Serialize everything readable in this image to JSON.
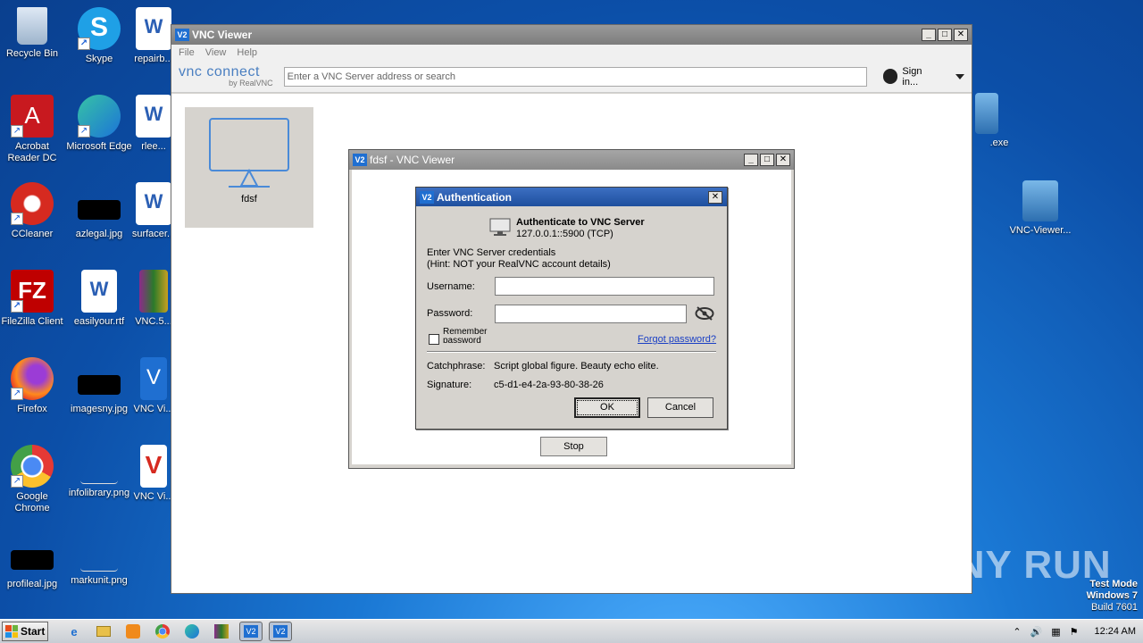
{
  "desktop": {
    "icons": [
      {
        "label": "Recycle Bin"
      },
      {
        "label": "Skype"
      },
      {
        "label": "repairb..."
      },
      {
        "label": "Acrobat Reader DC"
      },
      {
        "label": "Microsoft Edge"
      },
      {
        "label": "rlee..."
      },
      {
        "label": "CCleaner"
      },
      {
        "label": "azlegal.jpg"
      },
      {
        "label": "surfacer..."
      },
      {
        "label": "FileZilla Client"
      },
      {
        "label": "easilyour.rtf"
      },
      {
        "label": "VNC.5..."
      },
      {
        "label": "Firefox"
      },
      {
        "label": "imagesny.jpg"
      },
      {
        "label": "VNC Vi..."
      },
      {
        "label": "Google Chrome"
      },
      {
        "label": "infolibrary.png"
      },
      {
        "label": "VNC Vi..."
      },
      {
        "label": "profileal.jpg"
      },
      {
        "label": "markunit.png"
      },
      {
        "label": ".exe"
      },
      {
        "label": "VNC-Viewer..."
      }
    ]
  },
  "main_window": {
    "title": "VNC Viewer",
    "menu": [
      "File",
      "View",
      "Help"
    ],
    "brand_top": "vnc connect",
    "brand_bottom": "by RealVNC",
    "search_placeholder": "Enter a VNC Server address or search",
    "signin": "Sign in...",
    "tile_label": "fdsf"
  },
  "session_window": {
    "title": "fdsf - VNC Viewer",
    "stop_label": "Stop"
  },
  "auth_dialog": {
    "title": "Authentication",
    "heading": "Authenticate to VNC Server",
    "server": "127.0.0.1::5900 (TCP)",
    "prompt_line1": "Enter VNC Server credentials",
    "prompt_line2": "(Hint: NOT your RealVNC account details)",
    "username_label": "Username:",
    "username_value": "",
    "password_label": "Password:",
    "password_value": "",
    "remember_label": "Remember password",
    "forgot_label": "Forgot password?",
    "catchphrase_label": "Catchphrase:",
    "catchphrase_value": "Script global figure. Beauty echo elite.",
    "signature_label": "Signature:",
    "signature_value": "c5-d1-e4-2a-93-80-38-26",
    "ok_label": "OK",
    "cancel_label": "Cancel"
  },
  "watermark": {
    "text": "ANY RUN",
    "test_mode": "Test Mode",
    "os": "Windows 7",
    "build": "Build 7601"
  },
  "taskbar": {
    "start_label": "Start",
    "clock": "12:24 AM"
  }
}
